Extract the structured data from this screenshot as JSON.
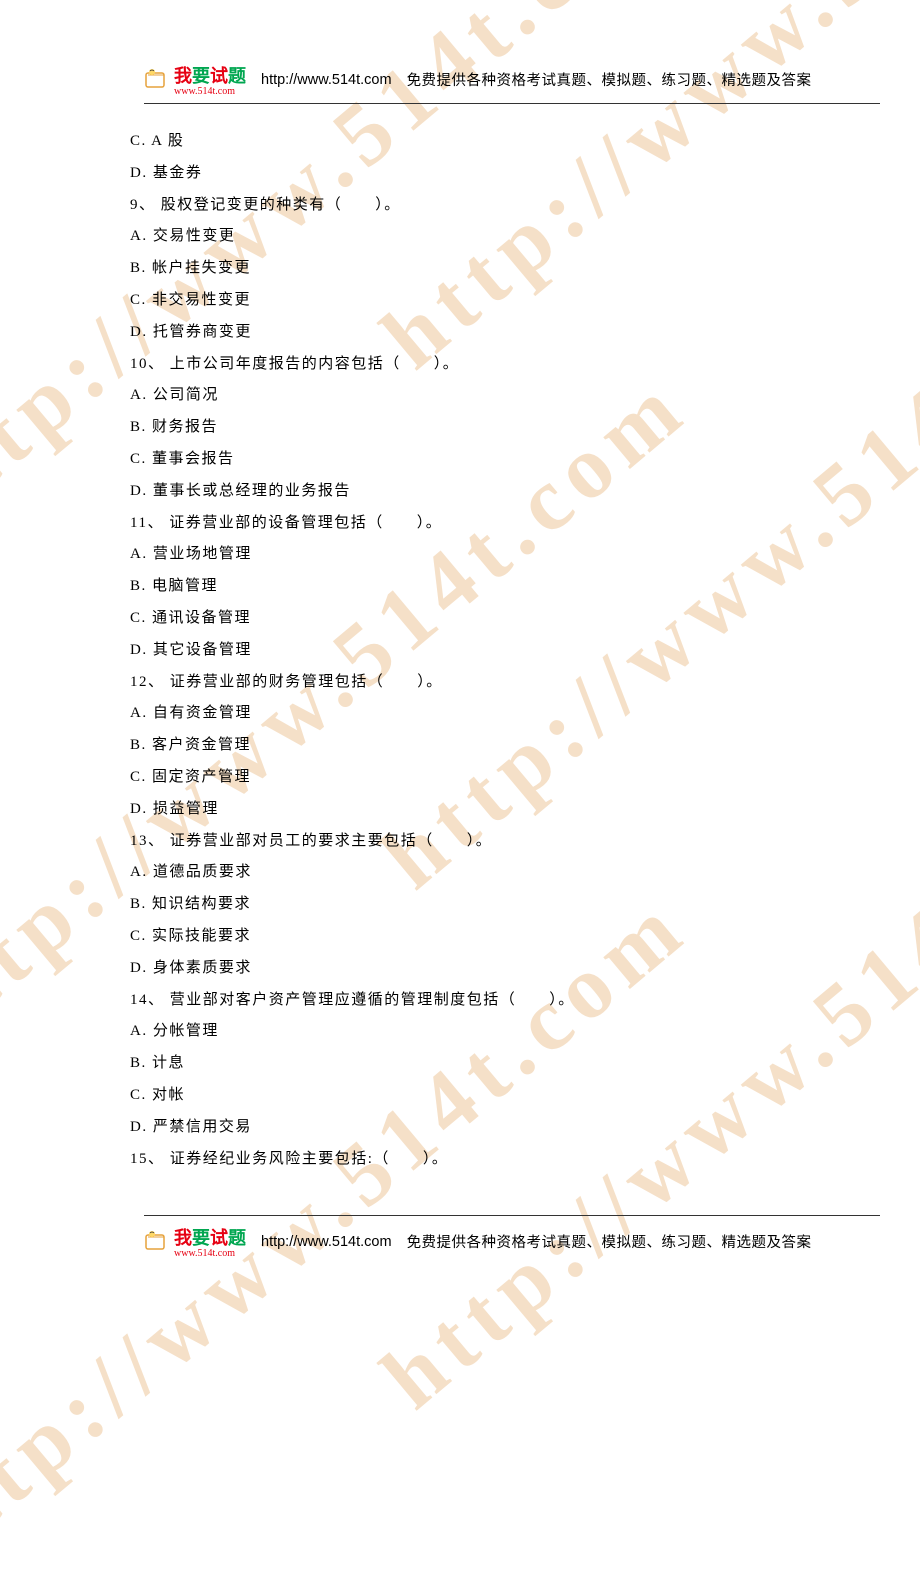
{
  "header": {
    "logo_name": "我要试题",
    "logo_url": "www.514t.com",
    "url": "http://www.514t.com",
    "desc": "免费提供各种资格考试真题、模拟题、练习题、精选题及答案"
  },
  "lines": [
    "C. A 股",
    "D. 基金券",
    "9、 股权登记变更的种类有（　　）。",
    "A. 交易性变更",
    "B. 帐户挂失变更",
    "C. 非交易性变更",
    "D. 托管券商变更",
    "10、 上市公司年度报告的内容包括（　　）。",
    "A. 公司简况",
    "B. 财务报告",
    "C. 董事会报告",
    "D. 董事长或总经理的业务报告",
    "11、 证券营业部的设备管理包括（　　）。",
    "A. 营业场地管理",
    "B. 电脑管理",
    "C. 通讯设备管理",
    "D. 其它设备管理",
    "12、 证券营业部的财务管理包括（　　）。",
    "A. 自有资金管理",
    "B. 客户资金管理",
    "C. 固定资产管理",
    "D. 损益管理",
    "13、 证券营业部对员工的要求主要包括（　　）。",
    "A. 道德品质要求",
    "B. 知识结构要求",
    "C. 实际技能要求",
    "D. 身体素质要求",
    "14、 营业部对客户资产管理应遵循的管理制度包括（　　）。",
    "A. 分帐管理",
    "B. 计息",
    "C. 对帐",
    "D. 严禁信用交易",
    "15、 证券经纪业务风险主要包括:（　　）。"
  ],
  "watermark_text": "http://www.514t.com"
}
